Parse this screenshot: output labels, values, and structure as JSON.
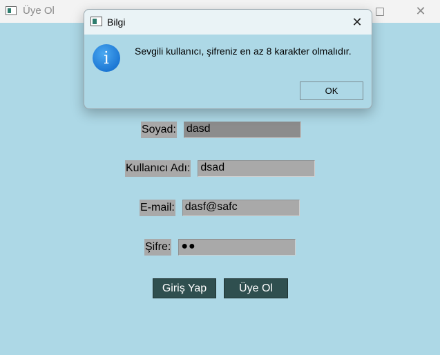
{
  "window": {
    "title": "Üye Ol",
    "icon": "app-window-icon",
    "maximize_icon": "maximize-icon",
    "close_icon": "close-icon",
    "close_glyph": "✕"
  },
  "form": {
    "surname_label": "Soyad:",
    "surname_value": "dasd",
    "username_label": "Kullanıcı Adı:",
    "username_value": "dsad",
    "email_label": "E-mail:",
    "email_value": "dasf@safc",
    "password_label": "Şifre:",
    "password_value": "●●",
    "login_button": "Giriş Yap",
    "register_button": "Üye Ol"
  },
  "dialog": {
    "title": "Bilgi",
    "close_glyph": "✕",
    "info_glyph": "i",
    "message": "Sevgili kullanıcı, şifreniz en az 8 karakter olmalıdır.",
    "ok_label": "OK"
  },
  "colors": {
    "background": "#add8e6",
    "field_background": "#a9a9a9",
    "button_background": "#2f4f4f",
    "info_icon": "#0a63c9"
  }
}
